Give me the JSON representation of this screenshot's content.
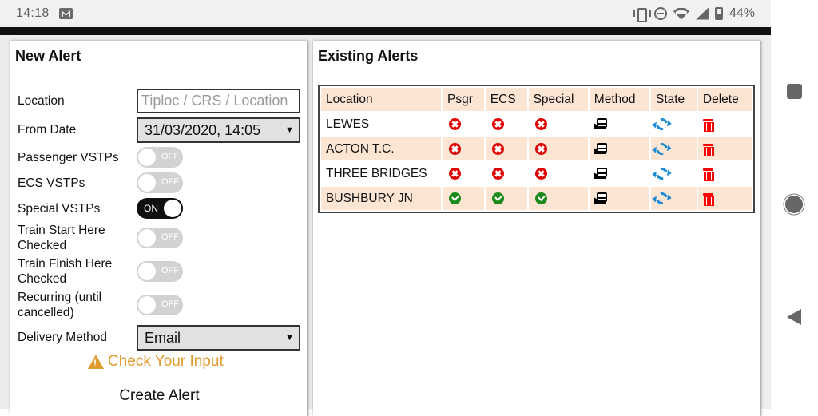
{
  "status_bar": {
    "time": "14:18",
    "notification_icon": "gmail-icon",
    "battery_percent": "44%",
    "icons": [
      "vibrate-icon",
      "do-not-disturb-icon",
      "wifi-icon",
      "cellular-signal-icon",
      "battery-icon"
    ]
  },
  "nav_bar": {
    "buttons": [
      "recents-button",
      "home-button",
      "back-button"
    ]
  },
  "new_alert": {
    "title": "New Alert",
    "location_label": "Location",
    "location_placeholder": "Tiploc / CRS / Location",
    "location_value": "",
    "from_date_label": "From Date",
    "from_date_value": "31/03/2020, 14:05",
    "toggles": [
      {
        "label": "Passenger VSTPs",
        "state": "OFF"
      },
      {
        "label": "ECS VSTPs",
        "state": "OFF"
      },
      {
        "label": "Special VSTPs",
        "state": "ON"
      },
      {
        "label": "Train Start Here Checked",
        "state": "OFF"
      },
      {
        "label": "Train Finish Here Checked",
        "state": "OFF"
      },
      {
        "label": "Recurring (until cancelled)",
        "state": "OFF"
      }
    ],
    "delivery_method_label": "Delivery Method",
    "delivery_method_value": "Email",
    "warning_text": "Check Your Input",
    "warning_color": "#e09a2e",
    "create_button": "Create Alert"
  },
  "existing_alerts": {
    "title": "Existing Alerts",
    "columns": [
      "Location",
      "Psgr",
      "ECS",
      "Special",
      "Method",
      "State",
      "Delete"
    ],
    "rows": [
      {
        "location": "LEWES",
        "psgr": "no",
        "ecs": "no",
        "special": "no",
        "method": "email-icon",
        "state": "sync-icon",
        "delete": "trash-icon"
      },
      {
        "location": "ACTON T.C.",
        "psgr": "no",
        "ecs": "no",
        "special": "no",
        "method": "email-icon",
        "state": "sync-icon",
        "delete": "trash-icon"
      },
      {
        "location": "THREE BRIDGES",
        "psgr": "no",
        "ecs": "no",
        "special": "no",
        "method": "email-icon",
        "state": "sync-icon",
        "delete": "trash-icon"
      },
      {
        "location": "BUSHBURY JN",
        "psgr": "yes",
        "ecs": "yes",
        "special": "yes",
        "method": "email-icon",
        "state": "sync-icon",
        "delete": "trash-icon"
      }
    ],
    "header_bg": "#fde5d3",
    "no_color": "#e10000",
    "yes_color": "#1a8a1a",
    "state_color": "#1a8ad4",
    "delete_color": "#ff0000"
  }
}
